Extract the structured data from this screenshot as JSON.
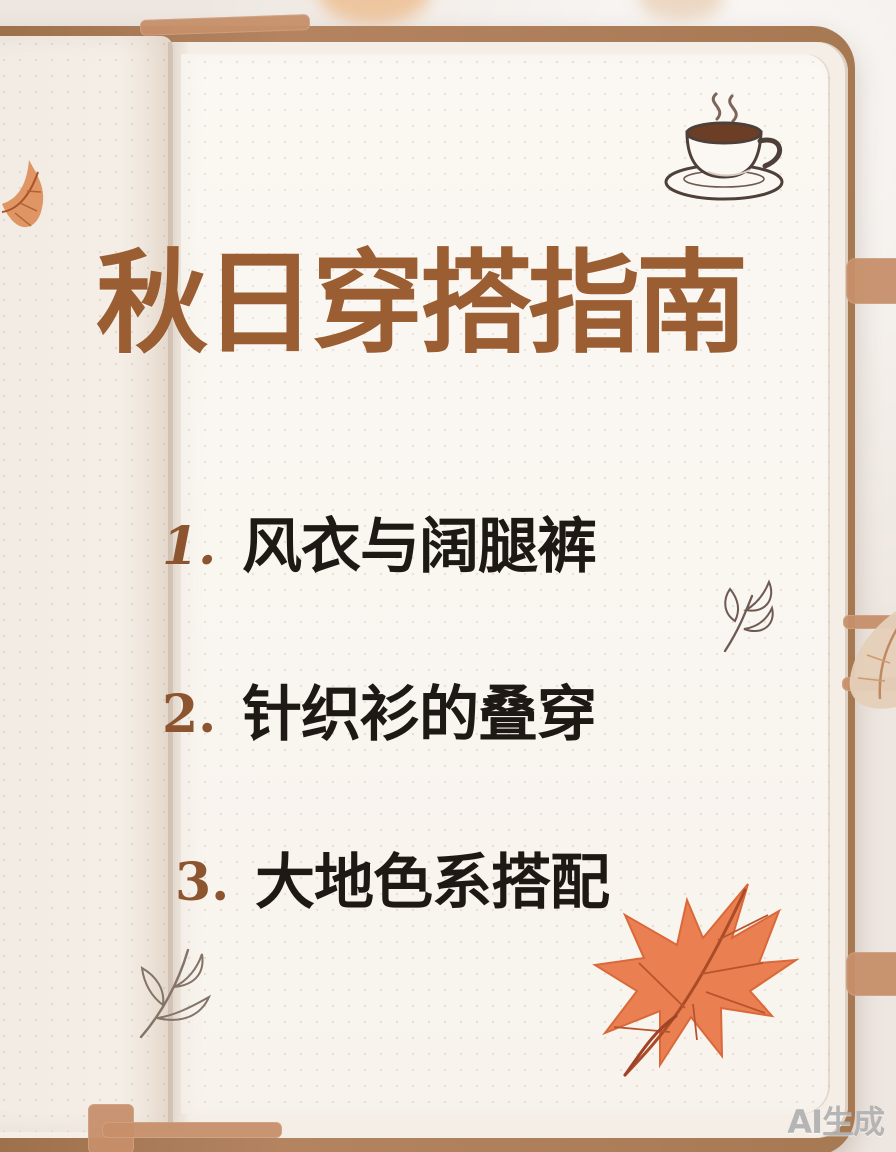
{
  "poster": {
    "title": "秋日穿搭指南",
    "items": [
      {
        "number": "1.",
        "text": "风衣与阔腿裤"
      },
      {
        "number": "2.",
        "text": "针织衫的叠穿"
      },
      {
        "number": "3.",
        "text": "大地色系搭配"
      }
    ],
    "watermark": "AI生成"
  },
  "decorations": {
    "icons": [
      "coffee-cup-icon",
      "autumn-leaf-icon",
      "maple-leaf-icon",
      "sprig-icon"
    ]
  },
  "colors": {
    "title": "#9b5d32",
    "number": "#8d552f",
    "body_text": "#1f1915",
    "page": "#f8f3ed",
    "cover": "#b48460",
    "leaf": "#e97b4c"
  }
}
